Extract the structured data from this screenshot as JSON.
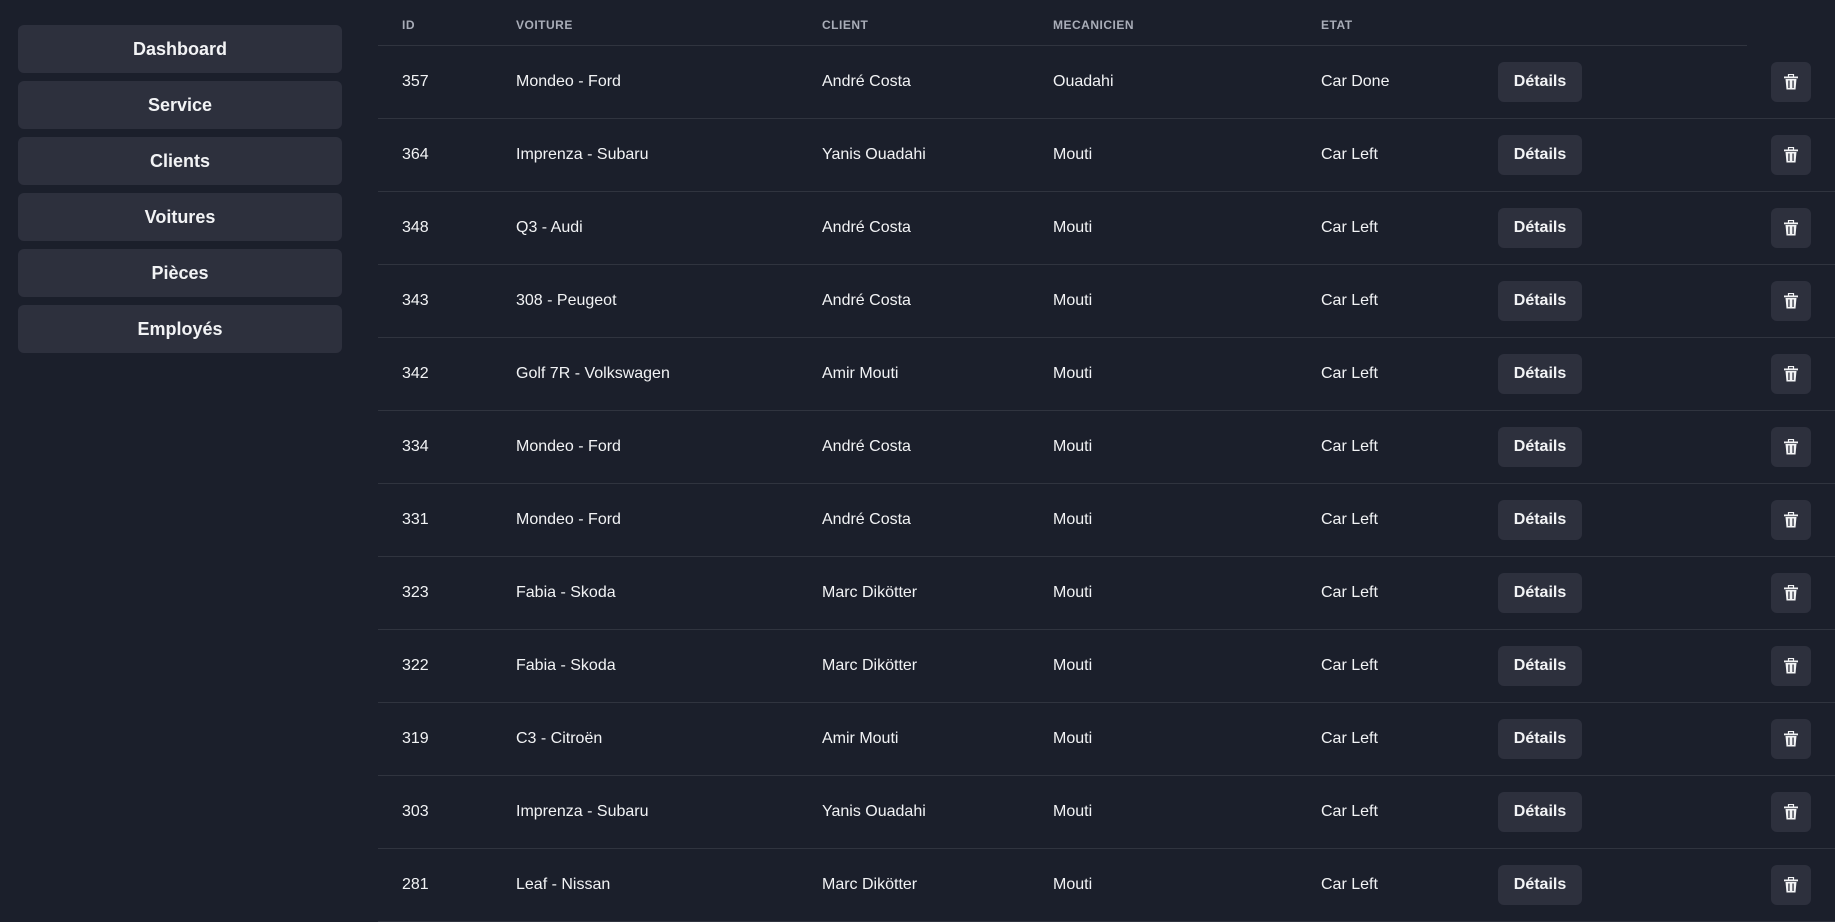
{
  "sidebar": {
    "items": [
      {
        "label": "Dashboard"
      },
      {
        "label": "Service"
      },
      {
        "label": "Clients"
      },
      {
        "label": "Voitures"
      },
      {
        "label": "Pièces"
      },
      {
        "label": "Employés"
      }
    ]
  },
  "table": {
    "headers": [
      "ID",
      "VOITURE",
      "CLIENT",
      "MECANICIEN",
      "ETAT"
    ],
    "details_label": "Détails",
    "delete_icon": "trash-icon",
    "rows": [
      [
        "357",
        "Mondeo - Ford",
        "André Costa",
        "Ouadahi",
        "Car Done"
      ],
      [
        "364",
        "Imprenza - Subaru",
        "Yanis Ouadahi",
        "Mouti",
        "Car Left"
      ],
      [
        "348",
        "Q3 - Audi",
        "André Costa",
        "Mouti",
        "Car Left"
      ],
      [
        "343",
        "308 - Peugeot",
        "André Costa",
        "Mouti",
        "Car Left"
      ],
      [
        "342",
        "Golf 7R - Volkswagen",
        "Amir Mouti",
        "Mouti",
        "Car Left"
      ],
      [
        "334",
        "Mondeo - Ford",
        "André Costa",
        "Mouti",
        "Car Left"
      ],
      [
        "331",
        "Mondeo - Ford",
        "André Costa",
        "Mouti",
        "Car Left"
      ],
      [
        "323",
        "Fabia - Skoda",
        "Marc Dikötter",
        "Mouti",
        "Car Left"
      ],
      [
        "322",
        "Fabia - Skoda",
        "Marc Dikötter",
        "Mouti",
        "Car Left"
      ],
      [
        "319",
        "C3 - Citroën",
        "Amir Mouti",
        "Mouti",
        "Car Left"
      ],
      [
        "303",
        "Imprenza - Subaru",
        "Yanis Ouadahi",
        "Mouti",
        "Car Left"
      ],
      [
        "281",
        "Leaf - Nissan",
        "Marc Dikötter",
        "Mouti",
        "Car Left"
      ]
    ]
  },
  "colors": {
    "background": "#1b1f2b",
    "button": "#2d303d",
    "divider": "#30343f"
  }
}
